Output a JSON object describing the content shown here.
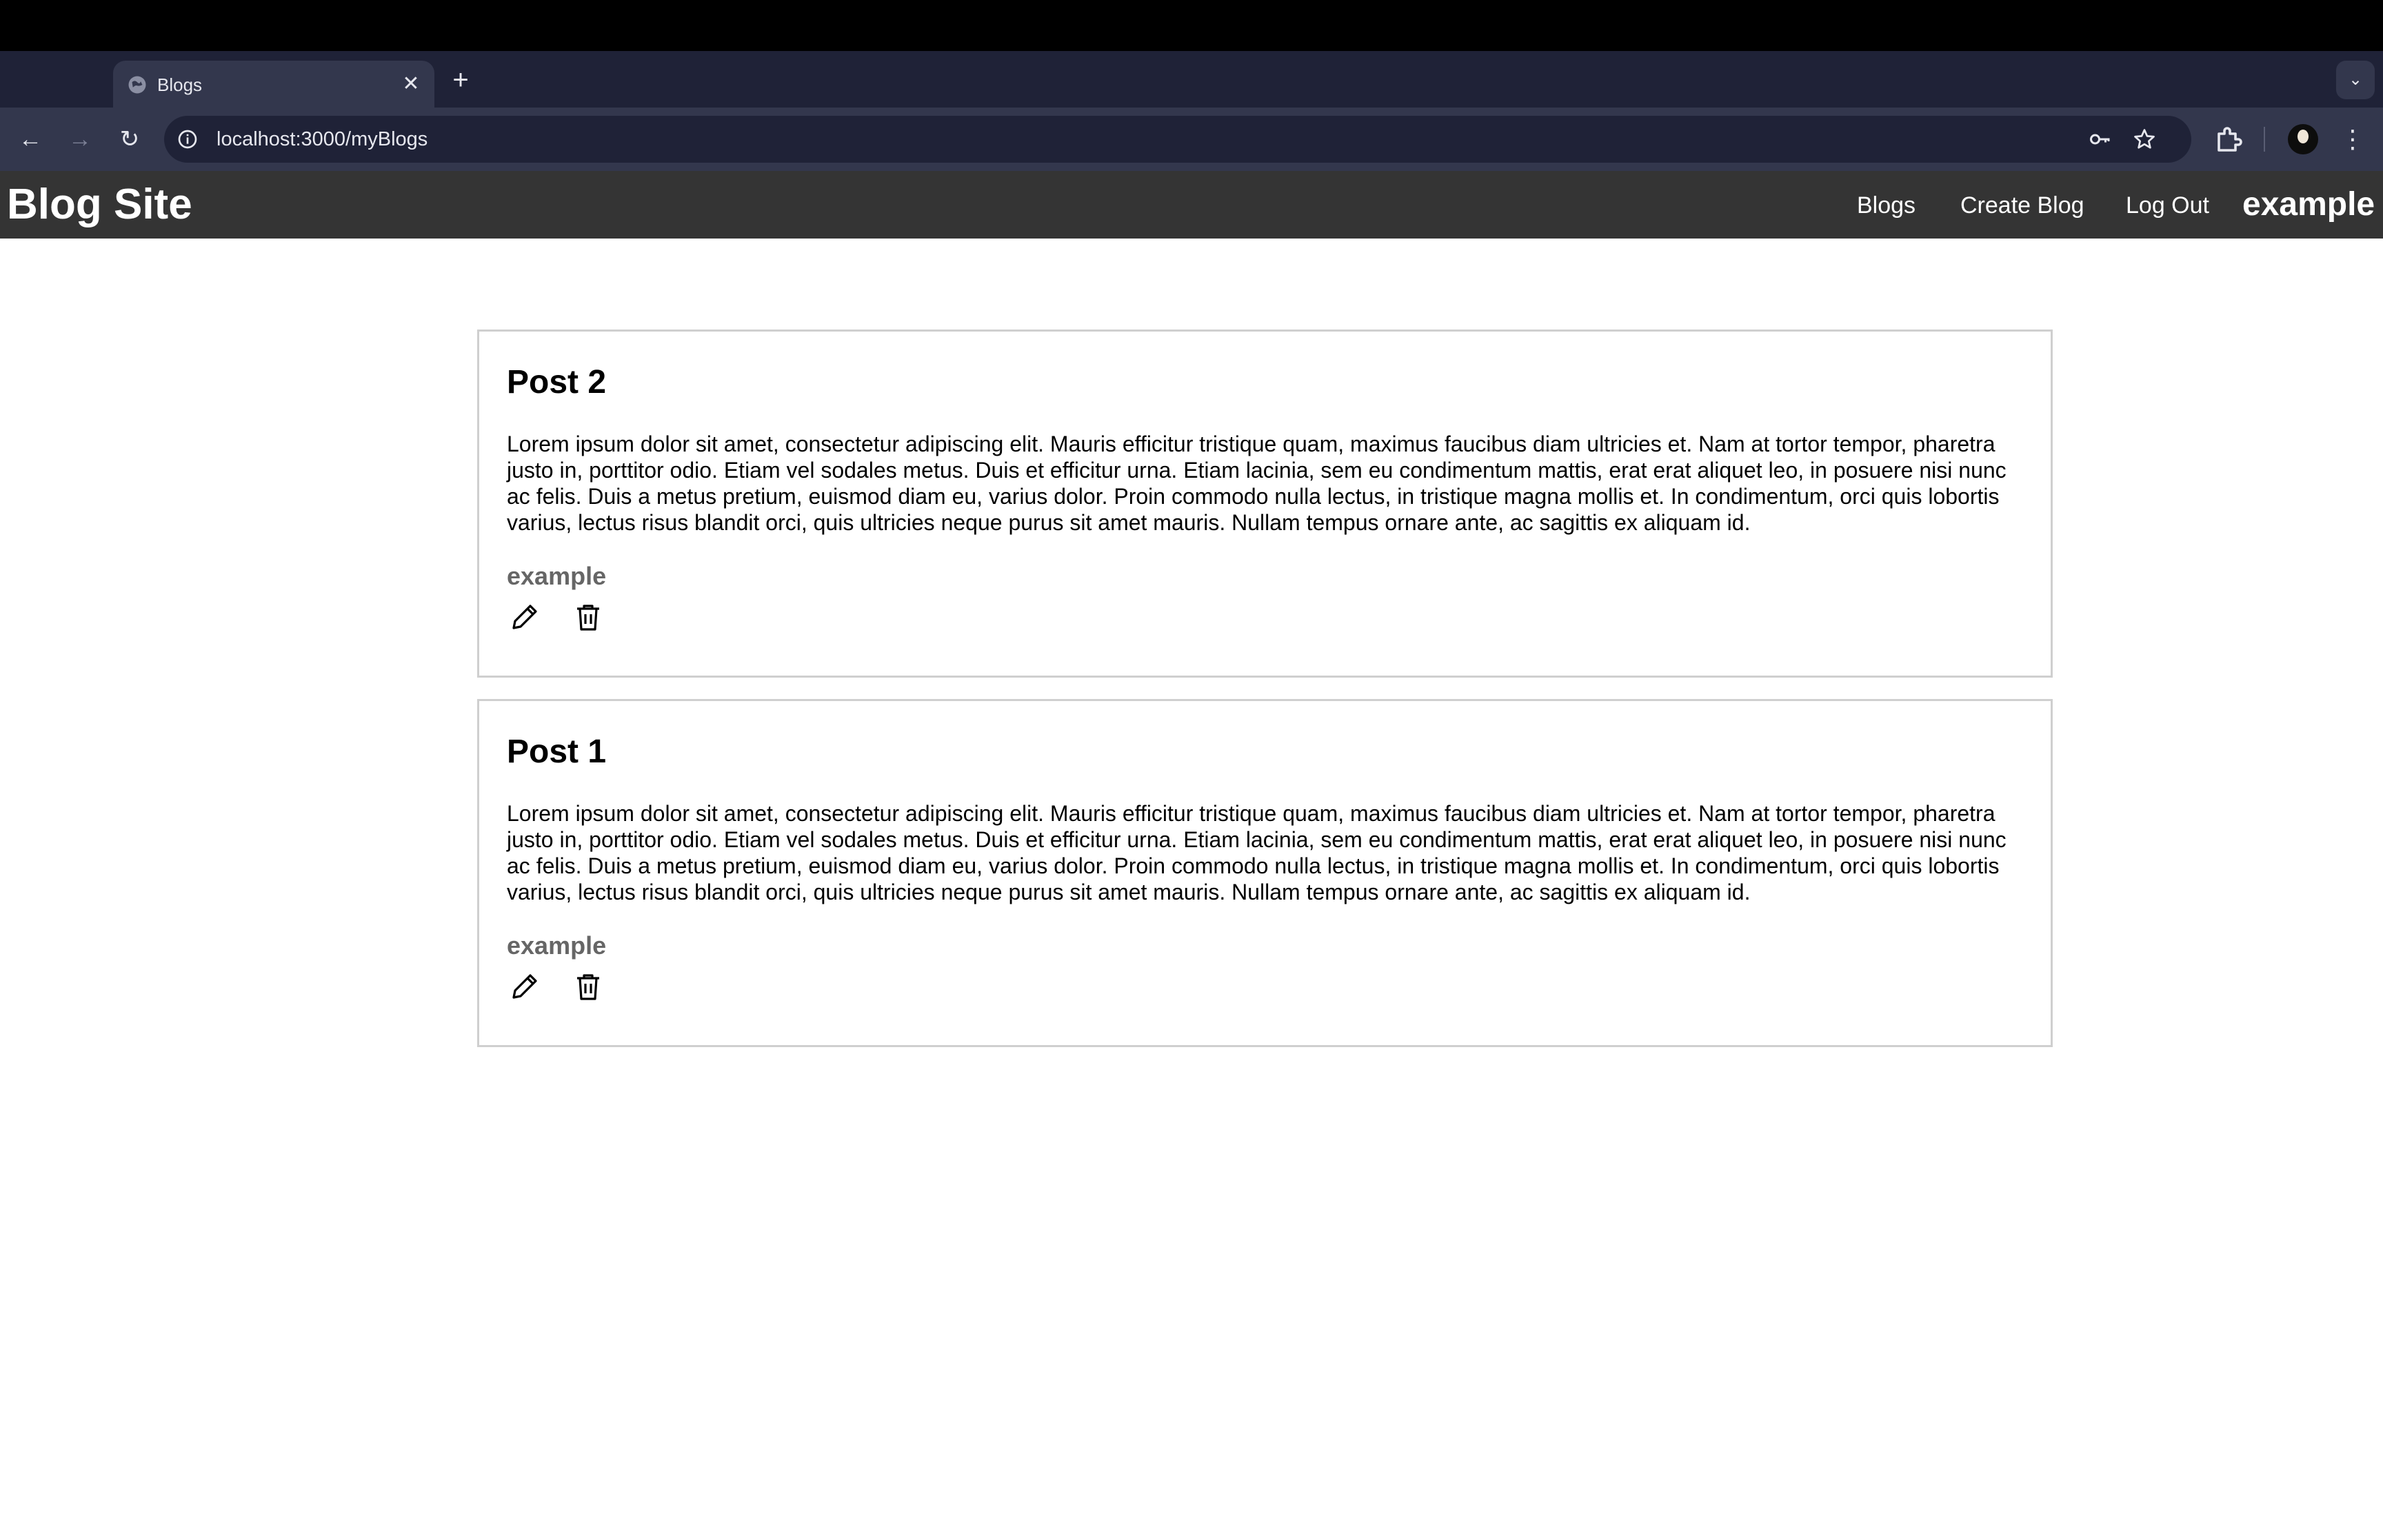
{
  "browser": {
    "tab": {
      "title": "Blogs",
      "close_glyph": "✕"
    },
    "new_tab_glyph": "+",
    "tab_search_glyph": "⌄",
    "nav": {
      "back_glyph": "←",
      "forward_glyph": "→",
      "reload_glyph": "↻"
    },
    "address": {
      "url": "localhost:3000/myBlogs"
    },
    "menu_glyph": "⋮",
    "icons": {
      "tab_favicon": "globe-icon",
      "site_info": "info-icon",
      "password": "key-icon",
      "bookmark": "star-icon",
      "extensions": "puzzle-icon",
      "profile": "avatar"
    }
  },
  "app": {
    "brand": "Blog Site",
    "nav": {
      "blogs": "Blogs",
      "create": "Create Blog",
      "logout": "Log Out",
      "user": "example"
    },
    "colors": {
      "nav_bg": "#343434",
      "author": "#666666"
    }
  },
  "posts": [
    {
      "title": "Post 2",
      "body": "Lorem ipsum dolor sit amet, consectetur adipiscing elit. Mauris efficitur tristique quam, maximus faucibus diam ultricies et. Nam at tortor tempor, pharetra justo in, porttitor odio. Etiam vel sodales metus. Duis et efficitur urna. Etiam lacinia, sem eu condimentum mattis, erat erat aliquet leo, in posuere nisi nunc ac felis. Duis a metus pretium, euismod diam eu, varius dolor. Proin commodo nulla lectus, in tristique magna mollis et. In condimentum, orci quis lobortis varius, lectus risus blandit orci, quis ultricies neque purus sit amet mauris. Nullam tempus ornare ante, ac sagittis ex aliquam id.",
      "author": "example",
      "actions": [
        "pencil-icon",
        "trash-icon"
      ]
    },
    {
      "title": "Post 1",
      "body": "Lorem ipsum dolor sit amet, consectetur adipiscing elit. Mauris efficitur tristique quam, maximus faucibus diam ultricies et. Nam at tortor tempor, pharetra justo in, porttitor odio. Etiam vel sodales metus. Duis et efficitur urna. Etiam lacinia, sem eu condimentum mattis, erat erat aliquet leo, in posuere nisi nunc ac felis. Duis a metus pretium, euismod diam eu, varius dolor. Proin commodo nulla lectus, in tristique magna mollis et. In condimentum, orci quis lobortis varius, lectus risus blandit orci, quis ultricies neque purus sit amet mauris. Nullam tempus ornare ante, ac sagittis ex aliquam id.",
      "author": "example",
      "actions": [
        "pencil-icon",
        "trash-icon"
      ]
    }
  ]
}
